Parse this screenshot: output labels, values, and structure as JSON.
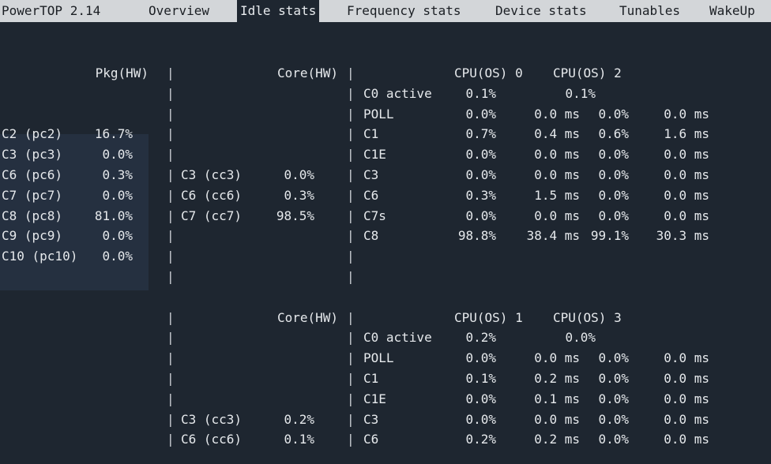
{
  "app": {
    "title": "PowerTOP 2.14",
    "tabs": [
      "Overview",
      "Idle stats",
      "Frequency stats",
      "Device stats",
      "Tunables",
      "WakeUp"
    ],
    "active_tab": "Idle stats"
  },
  "pkg": {
    "header": "Pkg(HW)",
    "rows": [
      {
        "label": "C2 (pc2)",
        "value": "16.7%"
      },
      {
        "label": "C3 (pc3)",
        "value": "0.0%"
      },
      {
        "label": "C6 (pc6)",
        "value": "0.3%"
      },
      {
        "label": "C7 (pc7)",
        "value": "0.0%"
      },
      {
        "label": "C8 (pc8)",
        "value": "81.0%"
      },
      {
        "label": "C9 (pc9)",
        "value": "0.0%"
      },
      {
        "label": "C10 (pc10)",
        "value": "0.0%"
      }
    ]
  },
  "core_groups": [
    {
      "header": "Core(HW)",
      "core_rows": [
        {
          "label": "C3 (cc3)",
          "value": "0.0%"
        },
        {
          "label": "C6 (cc6)",
          "value": "0.3%"
        },
        {
          "label": "C7 (cc7)",
          "value": "98.5%"
        }
      ],
      "cpu_a": "CPU(OS) 0",
      "cpu_b": "CPU(OS) 2",
      "c0_label": "C0 active",
      "c0_a": "0.1%",
      "c0_b": "0.1%",
      "states": [
        {
          "name": "POLL",
          "a_pct": "0.0%",
          "a_ms": "0.0 ms",
          "b_pct": "0.0%",
          "b_ms": "0.0 ms"
        },
        {
          "name": "C1",
          "a_pct": "0.7%",
          "a_ms": "0.4 ms",
          "b_pct": "0.6%",
          "b_ms": "1.6 ms"
        },
        {
          "name": "C1E",
          "a_pct": "0.0%",
          "a_ms": "0.0 ms",
          "b_pct": "0.0%",
          "b_ms": "0.0 ms"
        },
        {
          "name": "C3",
          "a_pct": "0.0%",
          "a_ms": "0.0 ms",
          "b_pct": "0.0%",
          "b_ms": "0.0 ms"
        },
        {
          "name": "C6",
          "a_pct": "0.3%",
          "a_ms": "1.5 ms",
          "b_pct": "0.0%",
          "b_ms": "0.0 ms"
        },
        {
          "name": "C7s",
          "a_pct": "0.0%",
          "a_ms": "0.0 ms",
          "b_pct": "0.0%",
          "b_ms": "0.0 ms"
        },
        {
          "name": "C8",
          "a_pct": "98.8%",
          "a_ms": "38.4 ms",
          "b_pct": "99.1%",
          "b_ms": "30.3 ms"
        }
      ]
    },
    {
      "header": "Core(HW)",
      "core_rows": [
        {
          "label": "C3 (cc3)",
          "value": "0.2%"
        },
        {
          "label": "C6 (cc6)",
          "value": "0.1%"
        }
      ],
      "cpu_a": "CPU(OS) 1",
      "cpu_b": "CPU(OS) 3",
      "c0_label": "C0 active",
      "c0_a": "0.2%",
      "c0_b": "0.0%",
      "states": [
        {
          "name": "POLL",
          "a_pct": "0.0%",
          "a_ms": "0.0 ms",
          "b_pct": "0.0%",
          "b_ms": "0.0 ms"
        },
        {
          "name": "C1",
          "a_pct": "0.1%",
          "a_ms": "0.2 ms",
          "b_pct": "0.0%",
          "b_ms": "0.0 ms"
        },
        {
          "name": "C1E",
          "a_pct": "0.0%",
          "a_ms": "0.1 ms",
          "b_pct": "0.0%",
          "b_ms": "0.0 ms"
        },
        {
          "name": "C3",
          "a_pct": "0.0%",
          "a_ms": "0.0 ms",
          "b_pct": "0.0%",
          "b_ms": "0.0 ms"
        },
        {
          "name": "C6",
          "a_pct": "0.2%",
          "a_ms": "0.2 ms",
          "b_pct": "0.0%",
          "b_ms": "0.0 ms"
        }
      ]
    }
  ]
}
